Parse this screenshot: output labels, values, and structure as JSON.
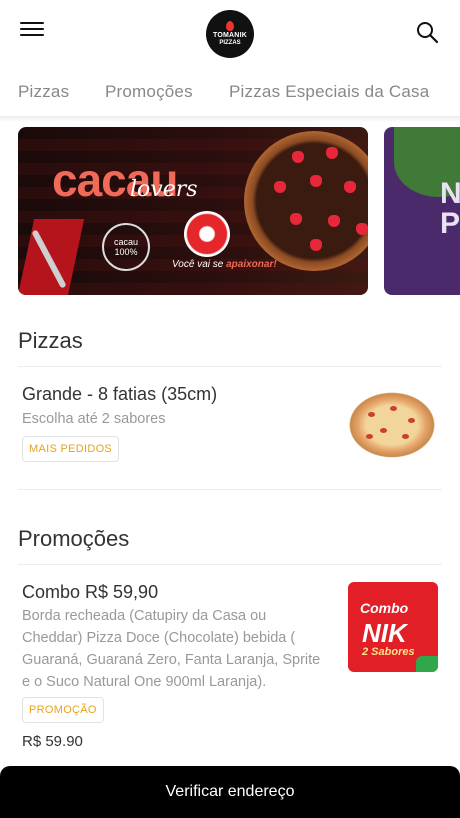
{
  "header": {
    "logo_line1": "TOMANIK",
    "logo_line2": "PIZZAS"
  },
  "tabs": [
    {
      "label": "Pizzas"
    },
    {
      "label": "Promoções"
    },
    {
      "label": "Pizzas Especiais da Casa"
    }
  ],
  "banners": [
    {
      "headline": "cacau",
      "script": "lovers",
      "seal_line1": "cacau",
      "seal_line2": "100%",
      "slogan_prefix": "Você vai se ",
      "slogan_highlight": "apaixonar!"
    },
    {
      "partial_text": "N\nP"
    }
  ],
  "sections": [
    {
      "title": "Pizzas",
      "items": [
        {
          "title": "Grande - 8 fatias (35cm)",
          "description": "Escolha até 2 sabores",
          "badge": "MAIS PEDIDOS"
        }
      ]
    },
    {
      "title": "Promoções",
      "items": [
        {
          "title": "Combo R$ 59,90",
          "description": "Borda recheada (Catupiry da Casa ou Cheddar) Pizza Doce (Chocolate) bebida ( Guaraná, Guaraná Zero, Fanta Laranja, Sprite e o Suco Natural One 900ml Laranja).",
          "badge": "PROMOÇÃO",
          "price": "R$ 59.90",
          "thumb_line1": "Combo",
          "thumb_line2": "NIK",
          "thumb_line3": "2 Sabores"
        }
      ]
    }
  ],
  "footer": {
    "button_label": "Verificar endereço"
  }
}
